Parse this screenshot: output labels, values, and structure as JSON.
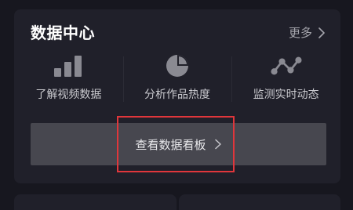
{
  "data_center": {
    "title": "数据中心",
    "more_label": "更多",
    "features": [
      {
        "label": "了解视频数据",
        "icon": "bar-chart-icon"
      },
      {
        "label": "分析作品热度",
        "icon": "pie-chart-icon"
      },
      {
        "label": "监测实时动态",
        "icon": "line-trend-icon"
      }
    ],
    "dashboard_button_label": "查看数据看板"
  },
  "colors": {
    "background": "#17171f",
    "card": "#20202a",
    "button": "#47474f",
    "icon": "#8a8a92",
    "highlight": "#e0363b"
  }
}
